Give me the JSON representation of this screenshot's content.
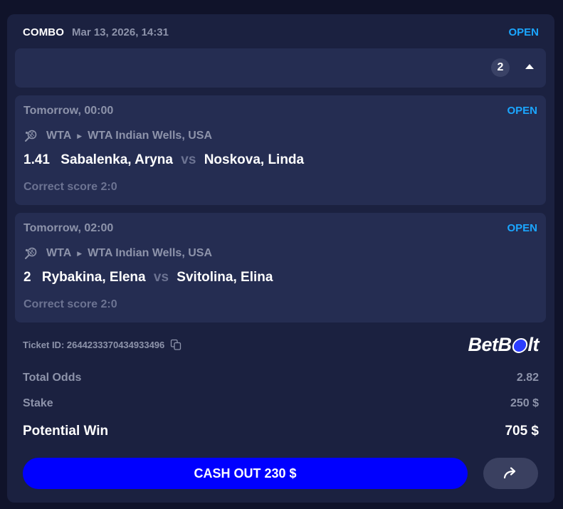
{
  "bet": {
    "type_label": "COMBO",
    "placed_at": "Mar 13, 2026, 14:31",
    "status": "OPEN",
    "selection_count": "2"
  },
  "selections": [
    {
      "time": "Tomorrow, 00:00",
      "status": "OPEN",
      "sport_icon": "tennis-icon",
      "league": "WTA",
      "tournament": "WTA Indian Wells, USA",
      "odds": "1.41",
      "home": "Sabalenka, Aryna",
      "vs": "vs",
      "away": "Noskova, Linda",
      "market": "Correct score 2:0"
    },
    {
      "time": "Tomorrow, 02:00",
      "status": "OPEN",
      "sport_icon": "tennis-icon",
      "league": "WTA",
      "tournament": "WTA Indian Wells, USA",
      "odds": "2",
      "home": "Rybakina, Elena",
      "vs": "vs",
      "away": "Svitolina, Elina",
      "market": "Correct score 2:0"
    }
  ],
  "ticket": {
    "id_label": "Ticket ID: 2644233370434933496"
  },
  "brand": {
    "part1": "BetB",
    "part2": "lt"
  },
  "summary": {
    "total_odds_label": "Total Odds",
    "total_odds_value": "2.82",
    "stake_label": "Stake",
    "stake_value": "250 $",
    "potential_win_label": "Potential Win",
    "potential_win_value": "705 $"
  },
  "actions": {
    "cashout_label": "CASH OUT 230 $",
    "share_icon": "share-arrow-icon"
  },
  "colors": {
    "accent_blue": "#1ba6ff",
    "cashout_blue": "#0000ff",
    "card_bg": "#1b2140",
    "panel_bg": "#252d52"
  }
}
